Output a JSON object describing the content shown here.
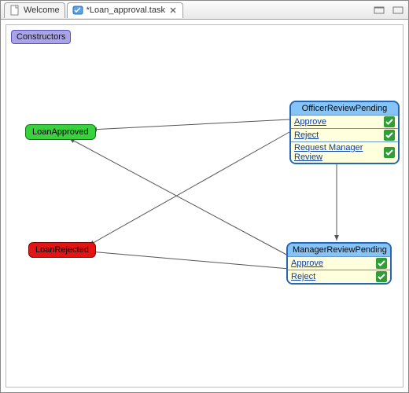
{
  "tabs": [
    {
      "label": "Welcome",
      "active": false
    },
    {
      "label": "*Loan_approval.task",
      "active": true,
      "closeable": true
    }
  ],
  "toolbar": {
    "constructors_label": "Constructors"
  },
  "nodes": {
    "officer": {
      "title": "OfficerReviewPending",
      "actions": [
        {
          "label": "Approve"
        },
        {
          "label": "Reject"
        },
        {
          "label": "Request Manager Review"
        }
      ]
    },
    "manager": {
      "title": "ManagerReviewPending",
      "actions": [
        {
          "label": "Approve"
        },
        {
          "label": "Reject"
        }
      ]
    },
    "approved": {
      "label": "LoanApproved"
    },
    "rejected": {
      "label": "LoanRejected"
    }
  },
  "chart_data": {
    "type": "diagram",
    "title": "Loan_approval task state diagram",
    "states": [
      {
        "id": "OfficerReviewPending",
        "kind": "task",
        "actions": [
          "Approve",
          "Reject",
          "Request Manager Review"
        ]
      },
      {
        "id": "ManagerReviewPending",
        "kind": "task",
        "actions": [
          "Approve",
          "Reject"
        ]
      },
      {
        "id": "LoanApproved",
        "kind": "terminal-success"
      },
      {
        "id": "LoanRejected",
        "kind": "terminal-failure"
      }
    ],
    "transitions": [
      {
        "from": "OfficerReviewPending",
        "action": "Approve",
        "to": "LoanApproved"
      },
      {
        "from": "OfficerReviewPending",
        "action": "Reject",
        "to": "LoanRejected"
      },
      {
        "from": "OfficerReviewPending",
        "action": "Request Manager Review",
        "to": "ManagerReviewPending"
      },
      {
        "from": "ManagerReviewPending",
        "action": "Approve",
        "to": "LoanApproved"
      },
      {
        "from": "ManagerReviewPending",
        "action": "Reject",
        "to": "LoanRejected"
      }
    ]
  }
}
